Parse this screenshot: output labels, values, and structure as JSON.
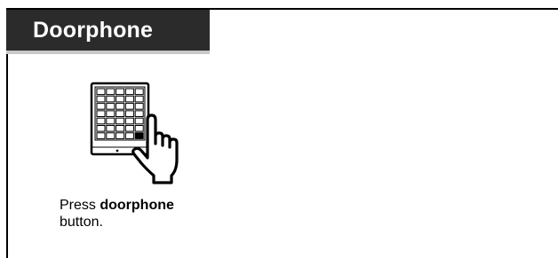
{
  "section": {
    "title": "Doorphone"
  },
  "step": {
    "icon": "keypad-press-icon",
    "text_before": "Press ",
    "text_bold": "doorphone",
    "text_after": "button."
  }
}
